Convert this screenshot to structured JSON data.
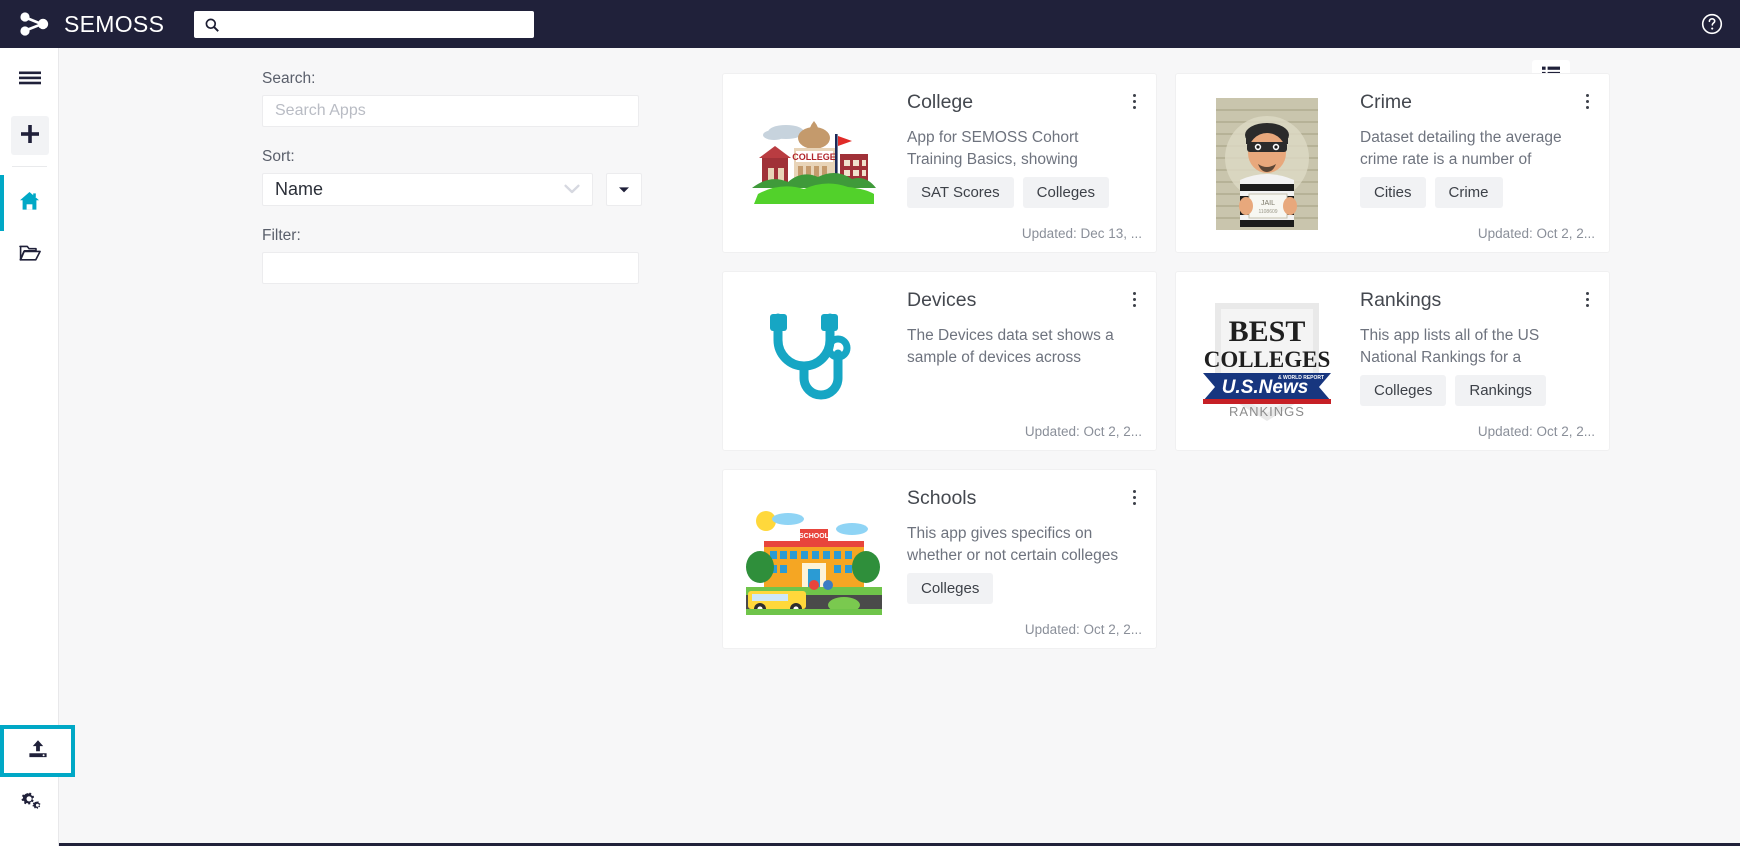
{
  "app": {
    "brand": "SEMOSS",
    "accent_teal": "#00a8c6",
    "topbar_color": "#20213a"
  },
  "topbar": {
    "search_value": "",
    "search_placeholder": "",
    "search_icon": "search-icon",
    "help_icon": "help-circle-icon",
    "logo_icon": "semoss-logo-icon"
  },
  "rail": {
    "items": [
      {
        "icon": "hamburger-menu-icon",
        "name": "menu-toggle",
        "active": false,
        "boxed": false
      },
      {
        "icon": "plus-icon",
        "name": "add-new",
        "active": false,
        "boxed": true
      },
      {
        "icon": "home-icon",
        "name": "home",
        "active": true,
        "boxed": false
      },
      {
        "icon": "folder-open-icon",
        "name": "projects",
        "active": false,
        "boxed": false
      }
    ],
    "upload": {
      "icon": "upload-icon",
      "name": "import-upload",
      "focused": true
    },
    "settings": {
      "icon": "gears-settings-icon",
      "name": "settings"
    }
  },
  "filters": {
    "search_label": "Search:",
    "search_placeholder": "Search Apps",
    "search_value": "",
    "sort_label": "Sort:",
    "sort_value": "Name",
    "sort_options": [
      "Name"
    ],
    "sort_direction_icon": "caret-down-icon",
    "filter_label": "Filter:",
    "filter_value": "",
    "filter_placeholder": ""
  },
  "toolbar": {
    "view_toggle_icon": "list-view-icon"
  },
  "cards": {
    "column_a": [
      {
        "title": "College",
        "description": "App for SEMOSS Cohort Training Basics, showing college",
        "tags": [
          "SAT Scores",
          "Colleges"
        ],
        "updated": "Updated: Dec 13, ...",
        "image": "college-campus-illustration",
        "menu_icon": "kebab-menu-icon"
      },
      {
        "title": "Devices",
        "description": "The Devices data set shows a sample of devices across",
        "tags": [],
        "updated": "Updated: Oct 2, 2...",
        "image": "stethoscope-illustration",
        "menu_icon": "kebab-menu-icon"
      },
      {
        "title": "Schools",
        "description": "This app gives specifics on whether or not certain colleges",
        "tags": [
          "Colleges"
        ],
        "updated": "Updated: Oct 2, 2...",
        "image": "school-building-bus-illustration",
        "menu_icon": "kebab-menu-icon"
      }
    ],
    "column_b": [
      {
        "title": "Crime",
        "description": "Dataset detailing the average crime rate is a number of cities.",
        "tags": [
          "Cities",
          "Crime"
        ],
        "updated": "Updated: Oct 2, 2...",
        "image": "criminal-mugshot-illustration",
        "menu_icon": "kebab-menu-icon"
      },
      {
        "title": "Rankings",
        "description": "This app lists all of the US National Rankings for a number",
        "tags": [
          "Colleges",
          "Rankings"
        ],
        "updated": "Updated: Oct 2, 2...",
        "image": "us-news-best-colleges-badge",
        "menu_icon": "kebab-menu-icon"
      }
    ]
  }
}
